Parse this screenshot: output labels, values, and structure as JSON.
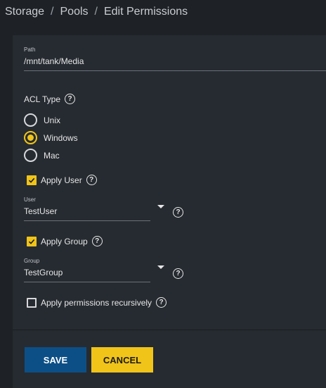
{
  "breadcrumb": {
    "items": [
      "Storage",
      "Pools",
      "Edit Permissions"
    ],
    "separator": "/"
  },
  "path": {
    "label": "Path",
    "value": "/mnt/tank/Media"
  },
  "acl_type": {
    "label": "ACL Type",
    "help": "?",
    "options": [
      {
        "label": "Unix",
        "selected": false
      },
      {
        "label": "Windows",
        "selected": true
      },
      {
        "label": "Mac",
        "selected": false
      }
    ]
  },
  "apply_user": {
    "label": "Apply User",
    "checked": true,
    "help": "?"
  },
  "user": {
    "label": "User",
    "value": "TestUser",
    "help": "?"
  },
  "apply_group": {
    "label": "Apply Group",
    "checked": true,
    "help": "?"
  },
  "group": {
    "label": "Group",
    "value": "TestGroup",
    "help": "?"
  },
  "recursive": {
    "label": "Apply permissions recursively",
    "checked": false,
    "help": "?"
  },
  "actions": {
    "save_label": "SAVE",
    "cancel_label": "CANCEL"
  },
  "colors": {
    "accent": "#f0c419",
    "primary": "#0c4f86",
    "background": "#1e2227",
    "card": "#262b31"
  }
}
